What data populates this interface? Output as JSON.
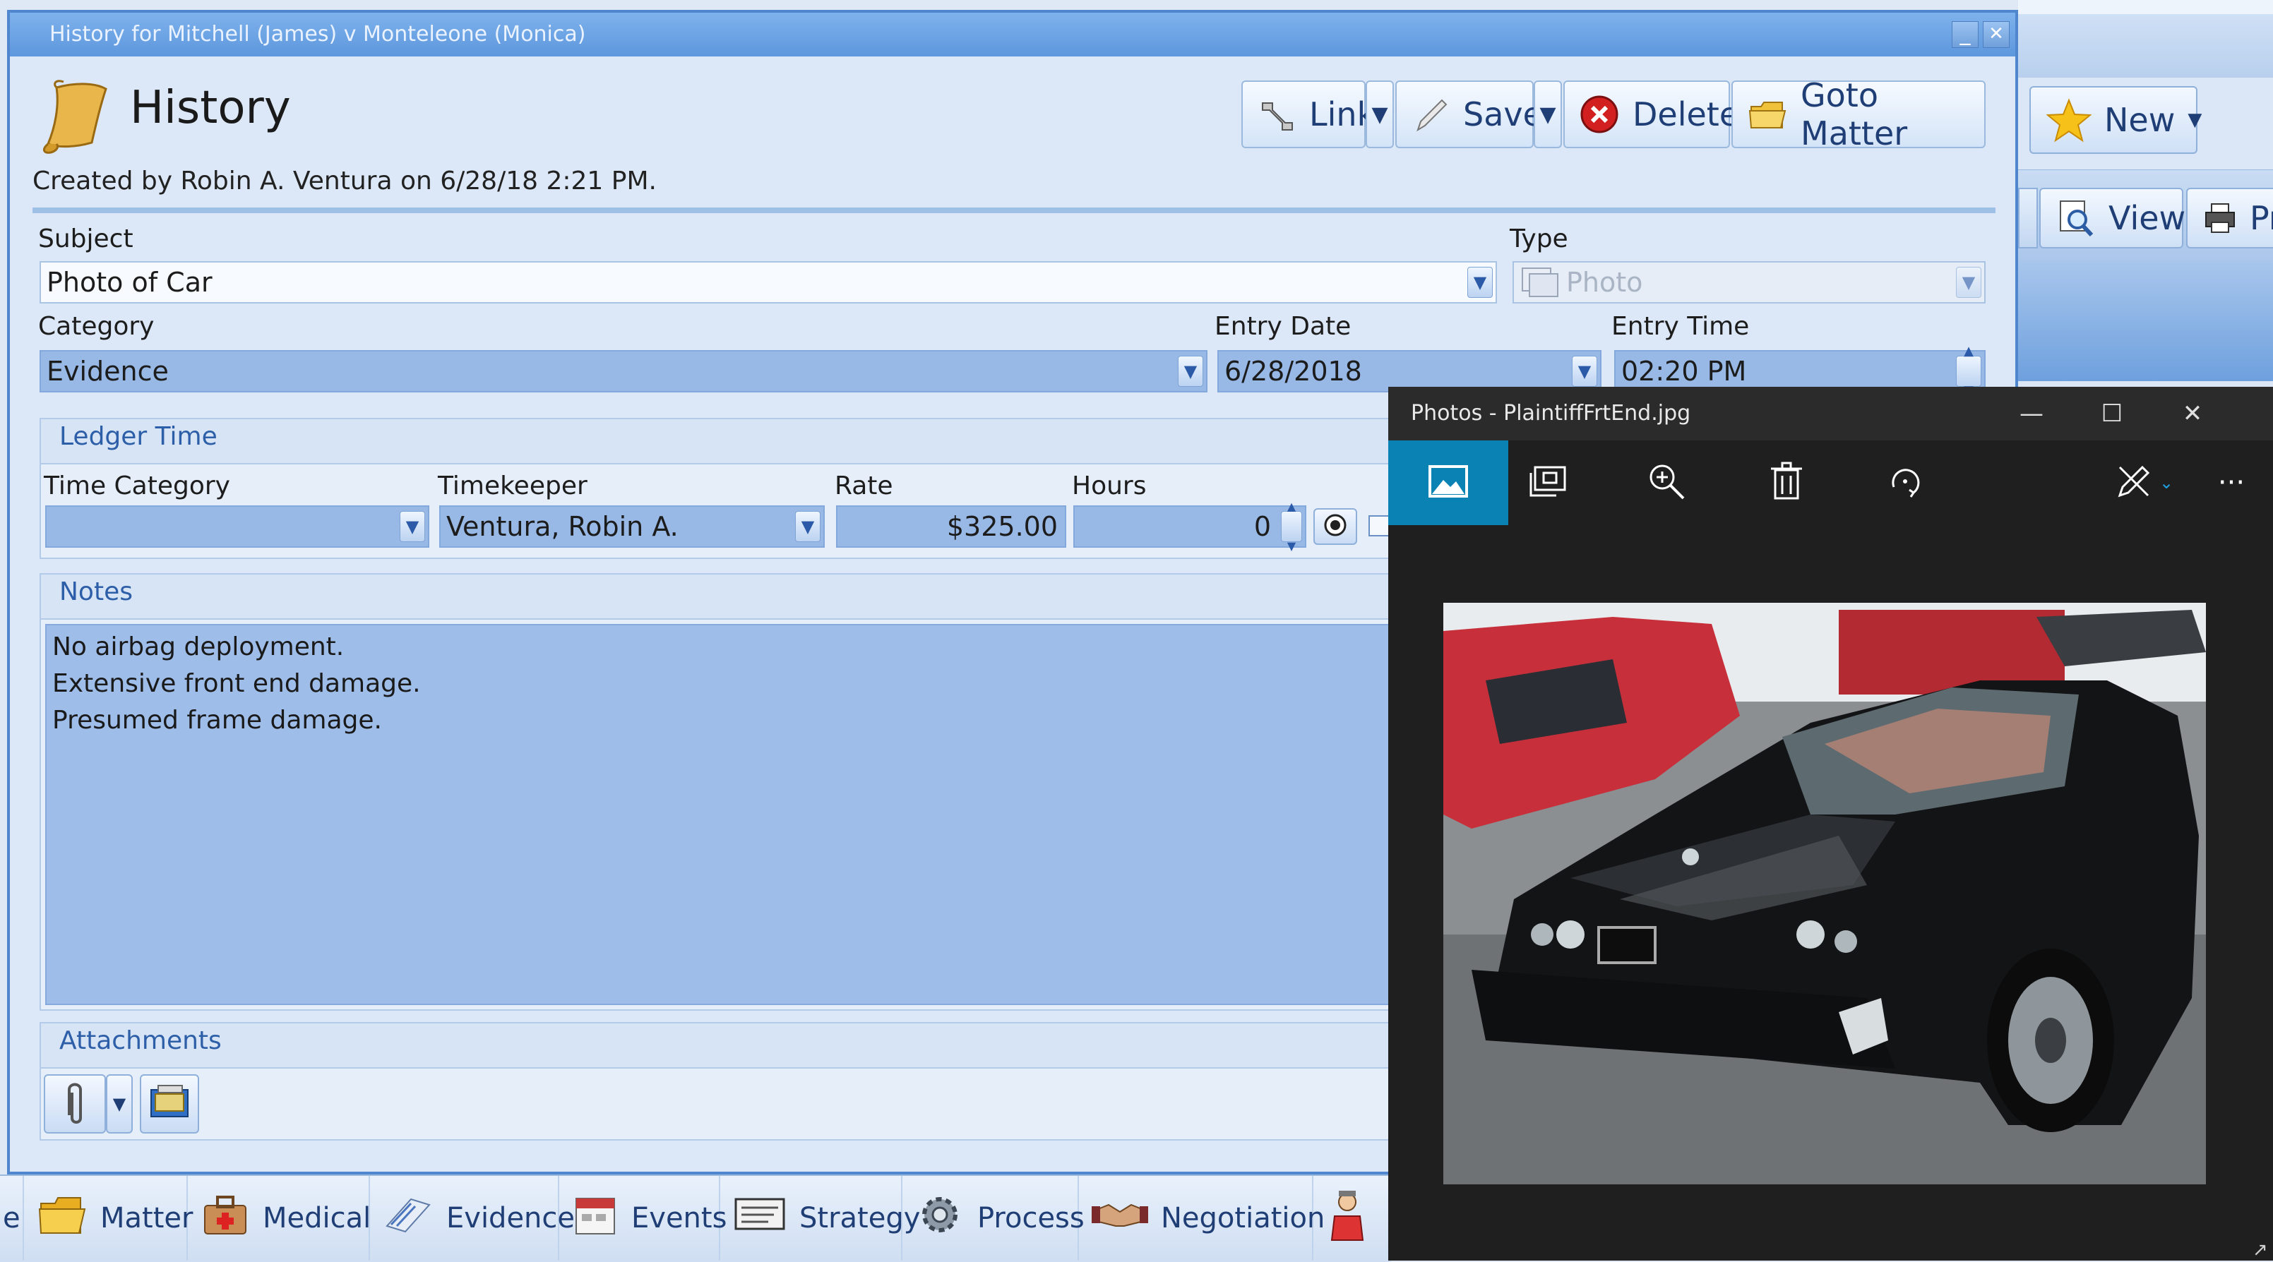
{
  "window": {
    "title": "History for Mitchell (James) v Monteleone (Monica)",
    "minimize": "_",
    "close": "✕"
  },
  "header": {
    "title": "History",
    "created": "Created by Robin A. Ventura on 6/28/18 2:21 PM."
  },
  "toolbar": {
    "link": "Link",
    "save": "Save",
    "delete": "Delete",
    "goto_matter": "Goto Matter"
  },
  "form": {
    "subject_label": "Subject",
    "subject_value": "Photo of Car",
    "type_label": "Type",
    "type_value": "Photo",
    "category_label": "Category",
    "category_value": "Evidence",
    "entry_date_label": "Entry Date",
    "entry_date_value": "6/28/2018",
    "entry_time_label": "Entry Time",
    "entry_time_value": "02:20 PM"
  },
  "ledger": {
    "header": "Ledger Time",
    "time_category_label": "Time Category",
    "time_category_value": "",
    "timekeeper_label": "Timekeeper",
    "timekeeper_value": "Ventura, Robin A.",
    "rate_label": "Rate",
    "rate_value": "$325.00",
    "hours_label": "Hours",
    "hours_value": "0"
  },
  "notes": {
    "header": "Notes",
    "lines": [
      "No airbag deployment.",
      "Extensive front end damage.",
      "Presumed frame damage."
    ]
  },
  "attachments": {
    "header": "Attachments"
  },
  "bottom_nav": {
    "partial": "e",
    "items": [
      "Matter",
      "Medical",
      "Evidence",
      "Events",
      "Strategy",
      "Process",
      "Negotiation"
    ]
  },
  "background_app": {
    "new": "New",
    "view": "View",
    "print_partial": "Pri"
  },
  "photos": {
    "title": "Photos - PlaintiffFrtEnd.jpg",
    "minimize": "—",
    "maximize": "☐",
    "close": "✕",
    "more": "···"
  },
  "colors": {
    "accent": "#4f86cd",
    "photos_active": "#0a82b4"
  }
}
